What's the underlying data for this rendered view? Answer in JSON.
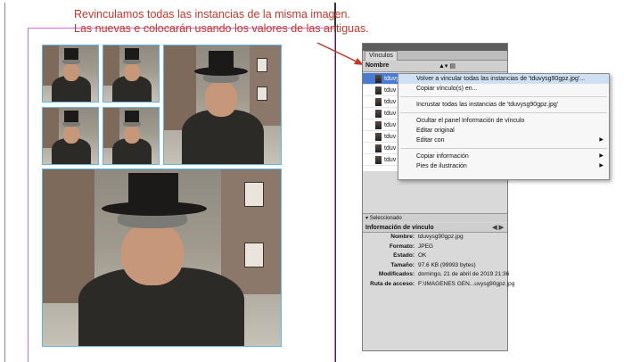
{
  "caption": {
    "line1": "Revinculamos todas las instancias de la misma imagen.",
    "line2": "Las nuevas e colocarán usando los valores de las antiguas."
  },
  "colors": {
    "caption": "#c0392b",
    "arrow": "#c0392b",
    "frame_border": "#5fb6e6",
    "margin_guide": "#d46bd6",
    "selection": "#4a7bd0",
    "menu_highlight": "#cfe0f5"
  },
  "links_panel": {
    "tab_label": "Vínculos",
    "column_name": "Nombre",
    "rows": [
      {
        "name": "tduvy...",
        "selected": true
      },
      {
        "name": "tduv",
        "selected": false
      },
      {
        "name": "tduv",
        "selected": false
      },
      {
        "name": "tduv",
        "selected": false
      },
      {
        "name": "tduv",
        "selected": false
      },
      {
        "name": "tduv",
        "selected": false
      },
      {
        "name": "tduv",
        "selected": false
      },
      {
        "name": "tduv",
        "selected": false
      }
    ],
    "status_text": "Seleccionado",
    "info_header": "Información de vínculo",
    "info": [
      {
        "key": "Nombre:",
        "value": "tduvysg90gpz.jpg"
      },
      {
        "key": "Formato:",
        "value": "JPEG"
      },
      {
        "key": "Estado:",
        "value": "OK"
      },
      {
        "key": "Tamaño:",
        "value": "97.6 KB (99993 bytes)"
      },
      {
        "key": "Modificados:",
        "value": "domingo, 21 de abril de 2019 21:36"
      },
      {
        "key": "Ruta de acceso:",
        "value": "F:\\IMAGENES GEN...uvysg90gpz.jpg"
      }
    ]
  },
  "context_menu": {
    "items": [
      {
        "label": "Volver a vincular todas las instancias de 'tduvysg90gpz.jpg'...",
        "submenu": false,
        "highlight": true
      },
      {
        "label": "Copiar vínculo(s) en...",
        "submenu": false
      },
      {
        "sep": true
      },
      {
        "label": "Incrustar todas las instancias de 'tduvysg90gpz.jpg'",
        "submenu": false
      },
      {
        "sep": true
      },
      {
        "label": "Ocultar el panel Información de vínculo",
        "submenu": false
      },
      {
        "label": "Editar original",
        "submenu": false
      },
      {
        "label": "Editar con",
        "submenu": true
      },
      {
        "sep": true
      },
      {
        "label": "Copiar información",
        "submenu": true
      },
      {
        "label": "Pies de ilustración",
        "submenu": true
      }
    ]
  }
}
